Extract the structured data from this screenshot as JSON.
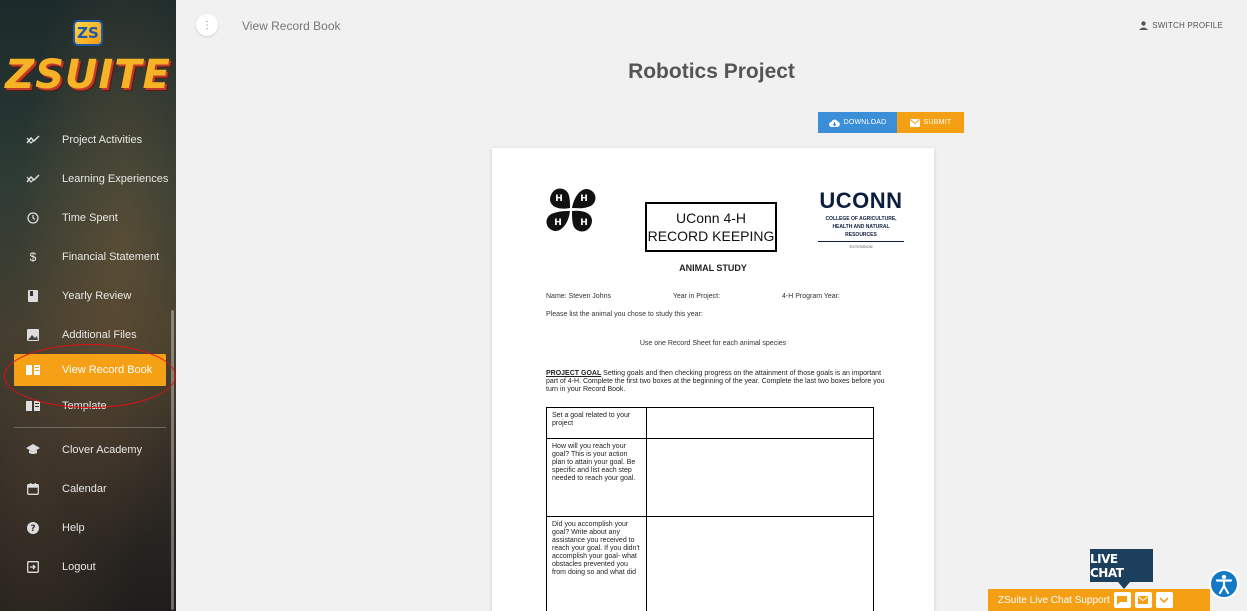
{
  "app": {
    "logo_badge": "ZS",
    "logo_text": "ZSUITE"
  },
  "sidebar": {
    "items": [
      {
        "label": "Project Activities",
        "icon": "trending-icon"
      },
      {
        "label": "Learning Experiences",
        "icon": "trending-icon"
      },
      {
        "label": "Time Spent",
        "icon": "clock-icon"
      },
      {
        "label": "Financial Statement",
        "icon": "dollar-icon"
      },
      {
        "label": "Yearly Review",
        "icon": "book-icon"
      },
      {
        "label": "Additional Files",
        "icon": "image-icon"
      },
      {
        "label": "View Record Book",
        "icon": "record-book-icon",
        "active": true
      },
      {
        "label": "Template",
        "icon": "record-book-icon"
      },
      {
        "label": "Clover Academy",
        "icon": "school-icon"
      },
      {
        "label": "Calendar",
        "icon": "calendar-icon"
      },
      {
        "label": "Help",
        "icon": "help-icon"
      },
      {
        "label": "Logout",
        "icon": "logout-icon"
      }
    ],
    "accent": "#f6a015"
  },
  "header": {
    "breadcrumb": "View Record Book",
    "switch_profile": "SWITCH PROFILE"
  },
  "main": {
    "title": "Robotics Project",
    "download_label": "DOWNLOAD",
    "submit_label": "SUBMIT"
  },
  "document": {
    "box_line1": "UConn 4-H",
    "box_line2": "RECORD KEEPING",
    "uconn_title": "UCONN",
    "uconn_sub1": "COLLEGE OF AGRICULTURE,",
    "uconn_sub2": "HEALTH AND NATURAL",
    "uconn_sub3": "RESOURCES",
    "uconn_ext": "EXTENSION",
    "heading": "ANIMAL STUDY",
    "name_field": "Name:  Steven Johns",
    "year_field": "Year in Project:",
    "program_field": "4-H Program Year:",
    "list_prompt": "Please list the animal you chose to study this year:",
    "one_sheet": "Use one Record Sheet for each animal species",
    "goal_label": "PROJECT GOAL",
    "goal_text": " Setting goals and then checking progress on the attainment of those goals is an important part of 4-H. Complete the first two boxes at the beginning of the year. Complete the last two boxes before you turn in your Record Book.",
    "rows": [
      "Set a goal related to your project",
      "How will you reach your goal? This is your action plan to attain your goal. Be specific and list each step needed to reach your goal.",
      "Did you accomplish your goal? Write about any assistance you received to reach your goal. If you didn't accomplish your goal- what obstacles prevented you from doing so and what did"
    ]
  },
  "chat": {
    "badge": "LIVE CHAT",
    "bar_label": "ZSuite Live Chat Support"
  }
}
